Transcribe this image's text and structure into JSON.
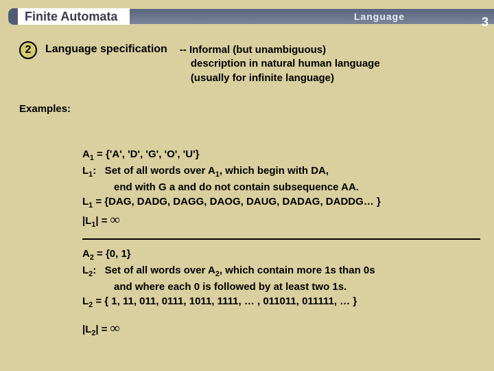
{
  "header": {
    "title": "Finite Automata",
    "section": "Language",
    "page": "3"
  },
  "section": {
    "number": "2",
    "label": "Language specification",
    "desc_l1": "-- Informal (but  unambiguous)",
    "desc_l2": "description in natural human language",
    "desc_l3": "(usually for infinite language)"
  },
  "examples_label": "Examples:",
  "ex1": {
    "a1": "A1 = {'A', 'D', 'G', 'O', 'U'}",
    "l1def_a": "L1:   Set of all words over A1, which begin with DA,",
    "l1def_b": "end with G a and do not contain subsequence AA.",
    "l1set": "L1 = {DAG, DADG, DAGG, DAOG, DAUG, DADAG, DADDG… }",
    "l1card_pre": "|L1| = ",
    "inf": "∞"
  },
  "ex2": {
    "a2": "A2 = {0, 1}",
    "l2def_a": "L2:   Set of all words over A2, which contain more 1s than 0s",
    "l2def_b": "and where each 0 is followed by at least two 1s.",
    "l2set": "L2 = { 1, 11, 011, 0111, 1011, 1111, … , 011011, 011111, … }",
    "l2card_pre": "|L2| = ",
    "inf": "∞"
  }
}
